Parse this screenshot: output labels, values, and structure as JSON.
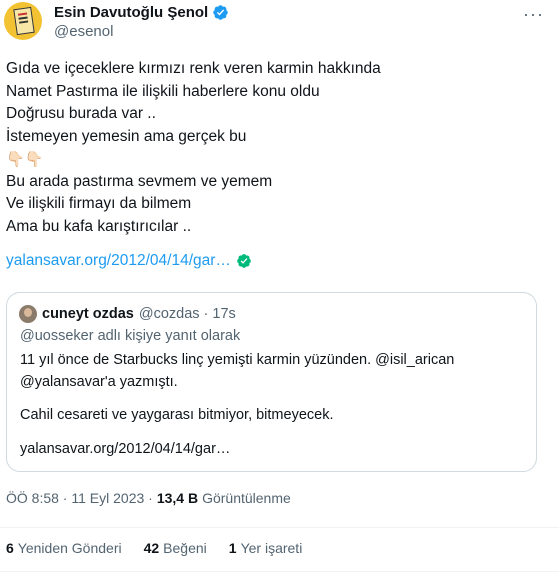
{
  "author": {
    "name": "Esin Davutoğlu Şenol",
    "handle": "@esenol",
    "verified_color": "#1d9bf0"
  },
  "more_icon": "more-horizontal-icon",
  "tweet": {
    "lines_a": [
      "Gıda ve içeceklere kırmızı renk veren karmin hakkında",
      "Namet Pastırma ile ilişkili haberlere konu oldu",
      "Doğrusu burada var ..",
      "İstemeyen yemesin ama gerçek bu"
    ],
    "emoji": "👇🏻👇🏻",
    "lines_b": [
      "Bu arada pastırma sevmem ve yemem",
      "Ve ilişkili firmayı da bilmem",
      "Ama bu kafa karıştırıcılar .."
    ],
    "link": "yalansavar.org/2012/04/14/gar…",
    "link_color": "#1d9bf0",
    "check_color": "#00ba7c"
  },
  "quote": {
    "name": "cuneyt ozdas",
    "handle_time": "@cozdas · 17s",
    "reply_to": "@uosseker adlı kişiye yanıt olarak",
    "lines": [
      "11 yıl önce de Starbucks linç yemişti karmin yüzünden. @isil_arican",
      "@yalansavar'a yazmıştı."
    ],
    "line2": "Cahil cesareti ve yaygarası bitmiyor, bitmeyecek.",
    "link": "yalansavar.org/2012/04/14/gar…"
  },
  "meta": {
    "time_date": "ÖÖ 8:58 · 11 Eyl 2023 ·",
    "views_count": "13,4 B",
    "views_label": "Görüntülenme"
  },
  "stats": {
    "retweets_count": "6",
    "retweets_label": "Yeniden Gönderi",
    "likes_count": "42",
    "likes_label": "Beğeni",
    "bookmarks_count": "1",
    "bookmarks_label": "Yer işareti"
  }
}
